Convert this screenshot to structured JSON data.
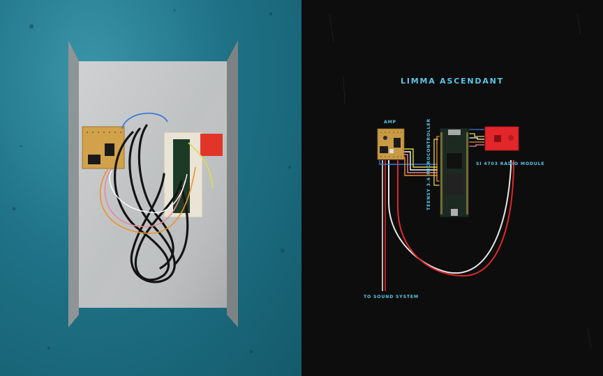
{
  "diagram": {
    "title": "LIMMA ASCENDANT",
    "labels": {
      "amp": "AMP",
      "microcontroller": "TEENSY 3.6 MICROCONTROLLER",
      "radio_module": "SI 4703 RADIO MODULE",
      "sound_system": "TO SOUND SYSTEM"
    },
    "colors": {
      "background": "#0d0d0e",
      "label": "#5cc6e4",
      "board_perf": "#c99a45",
      "teensy": "#1c2a22",
      "radio_board": "#e2262a",
      "cable_red": "#e02828",
      "cable_white": "#e8e8e8",
      "wire_blue": "#3a7bd5",
      "wire_orange": "#f0902a",
      "wire_yellow": "#e8d84a",
      "wire_pink": "#e88a9a"
    }
  },
  "photo": {
    "background_color": "#1f7287",
    "enclosure_color": "#b9bcbd"
  }
}
